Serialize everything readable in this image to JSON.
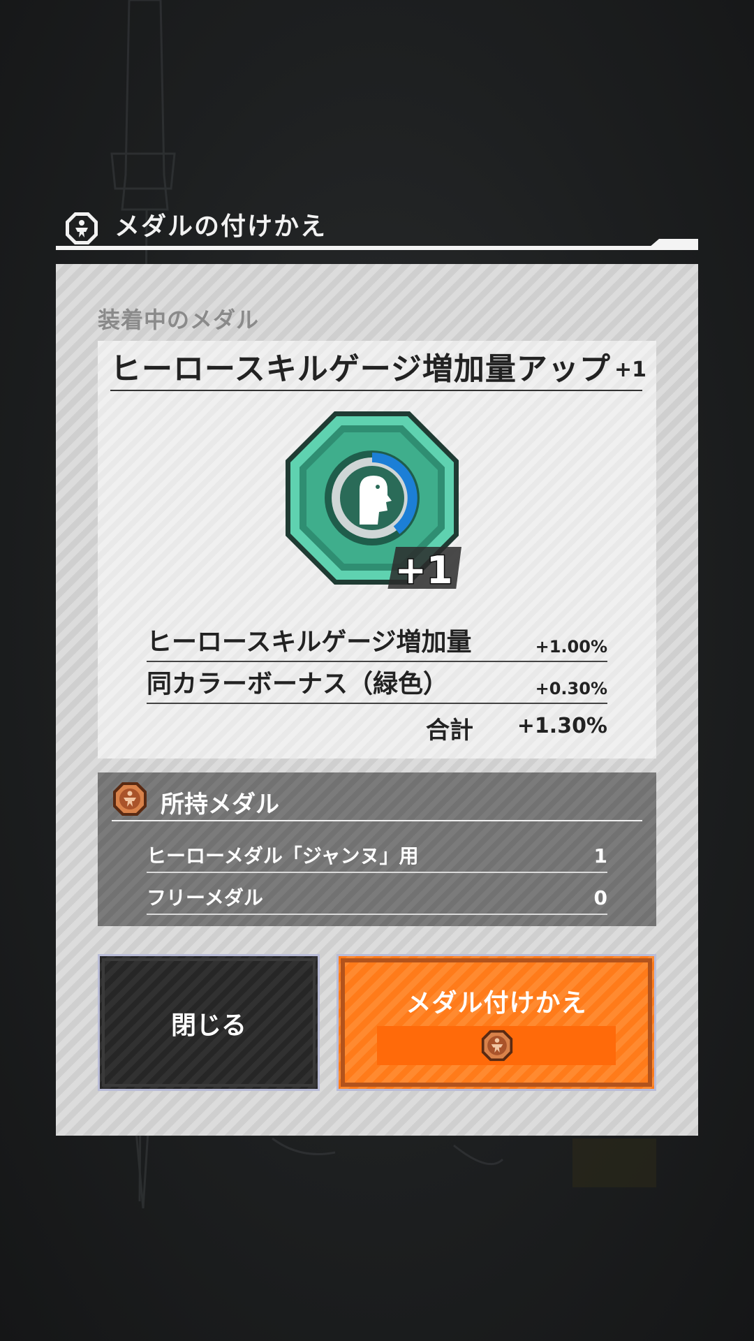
{
  "dialog": {
    "title": "メダルの付けかえ",
    "title_icon": "hero-medal-emblem-icon"
  },
  "equipped": {
    "section_label": "装着中のメダル",
    "medal_name": "ヒーロースキルゲージ増加量アップ",
    "medal_level": "+1",
    "medal_badge": "+1",
    "medal_color": "#3fae8c",
    "stats": [
      {
        "label": "ヒーロースキルゲージ増加量",
        "value": "+1.00%"
      },
      {
        "label": "同カラーボーナス（緑色）",
        "value": "+0.30%"
      }
    ],
    "total_label": "合計",
    "total_value": "+1.30%"
  },
  "owned": {
    "title": "所持メダル",
    "icon": "bronze-medal-icon",
    "items": [
      {
        "label": "ヒーローメダル「ジャンヌ」用",
        "value": "1"
      },
      {
        "label": "フリーメダル",
        "value": "0"
      }
    ]
  },
  "buttons": {
    "close_label": "閉じる",
    "swap_label": "メダル付けかえ",
    "swap_accent": "#ff7b1a"
  }
}
